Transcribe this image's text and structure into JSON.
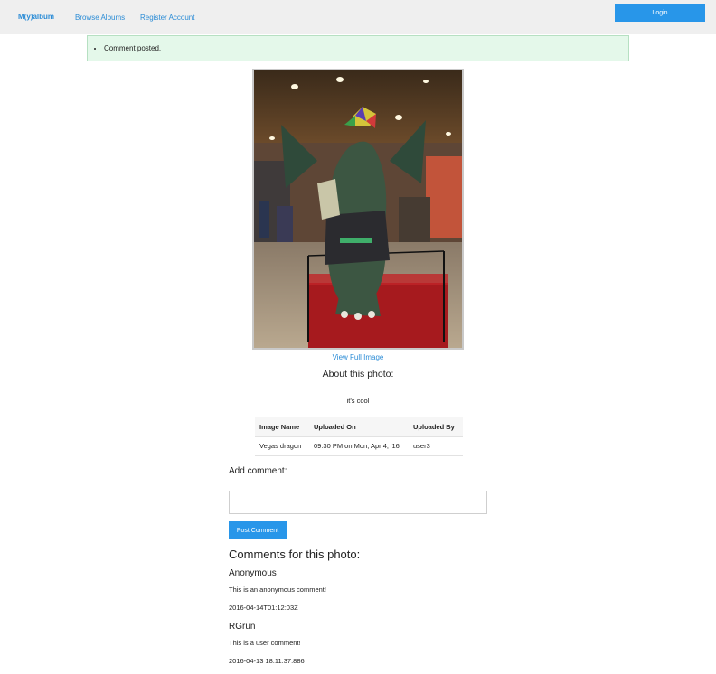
{
  "navbar": {
    "brand": "M(y)album",
    "links": [
      "Browse Albums",
      "Register Account"
    ],
    "login_label": "Login"
  },
  "flash": {
    "message": "Comment posted."
  },
  "photo": {
    "view_full_label": "View Full Image",
    "about_title": "About this photo:",
    "description": "it's cool"
  },
  "info_table": {
    "headers": [
      "Image Name",
      "Uploaded On",
      "Uploaded By"
    ],
    "row": [
      "Vegas dragon",
      "09:30 PM on Mon, Apr 4, '16",
      "user3"
    ]
  },
  "add_comment": {
    "title": "Add comment:",
    "value": "",
    "button_label": "Post Comment"
  },
  "comments": {
    "title": "Comments for this photo:",
    "items": [
      {
        "author": "Anonymous",
        "text": "This is an anonymous comment!",
        "timestamp": "2016-04-14T01:12:03Z"
      },
      {
        "author": "RGrun",
        "text": "This is a user comment!",
        "timestamp": "2016-04-13 18:11:37.886"
      }
    ]
  },
  "colors": {
    "accent": "#2896e9",
    "link": "#2b8cd6",
    "navbar_bg": "#efefef",
    "flash_bg": "#e4f8ea",
    "flash_border": "#b6e0c2"
  }
}
